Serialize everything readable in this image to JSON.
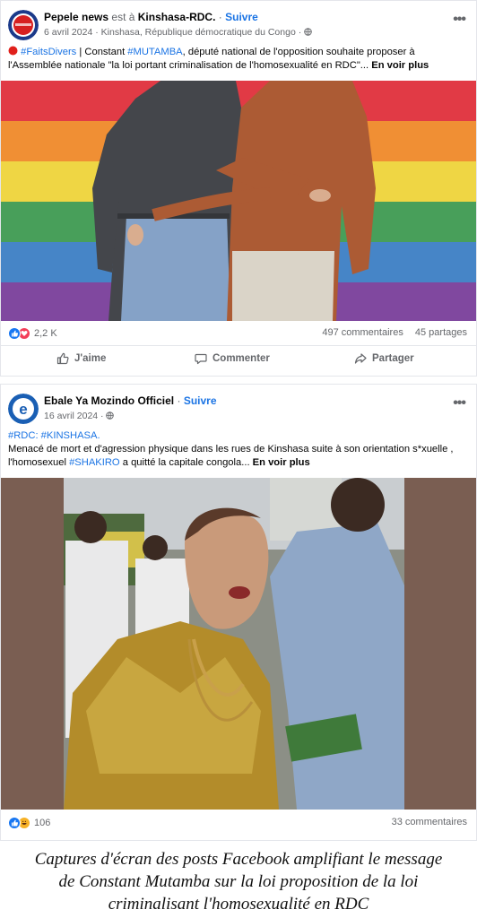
{
  "post1": {
    "page_name": "Pepele news",
    "location_prefix": "est à",
    "location": "Kinshasa-RDC.",
    "follow_label": "Suivre",
    "date": "6 avril 2024",
    "place": "Kinshasa, République démocratique du Congo",
    "more_label": "•••",
    "text": {
      "hashtag1": "#FaitsDivers",
      "part1": "| Constant",
      "hashtag2": "#MUTAMBA",
      "part2": ", député national de l'opposition souhaite proposer à l'Assemblée nationale \"la loi portant criminalisation de l'homosexualité en RDC\"...",
      "see_more": "En voir plus"
    },
    "reactions_count": "2,2 K",
    "comments": "497 commentaires",
    "shares": "45 partages",
    "actions": {
      "like": "J'aime",
      "comment": "Commenter",
      "share": "Partager"
    }
  },
  "post2": {
    "page_name": "Ebale Ya Mozindo Officiel",
    "follow_label": "Suivre",
    "date": "16 avril 2024",
    "more_label": "•••",
    "text": {
      "hashtags": "#RDC: #KINSHASA.",
      "part1": "Menacé de mort et d'agression physique dans les rues de Kinshasa suite à son orientation s*xuelle , l'homosexuel",
      "hashtag": "#SHAKIRO",
      "part2": "a quitté la capitale congola...",
      "see_more": "En voir plus"
    },
    "reactions_count": "106",
    "comments": "33 commentaires"
  },
  "caption": {
    "line1": "Captures d'écran des posts Facebook amplifiant le message",
    "line2": "de Constant Mutamba sur la loi proposition de la loi",
    "line3": "criminalisant l'homosexualité en RDC"
  },
  "colors": {
    "link": "#1b74e4",
    "like": "#1877f2",
    "love": "#f33e58",
    "haha": "#f7b125",
    "muted": "#65676b"
  }
}
